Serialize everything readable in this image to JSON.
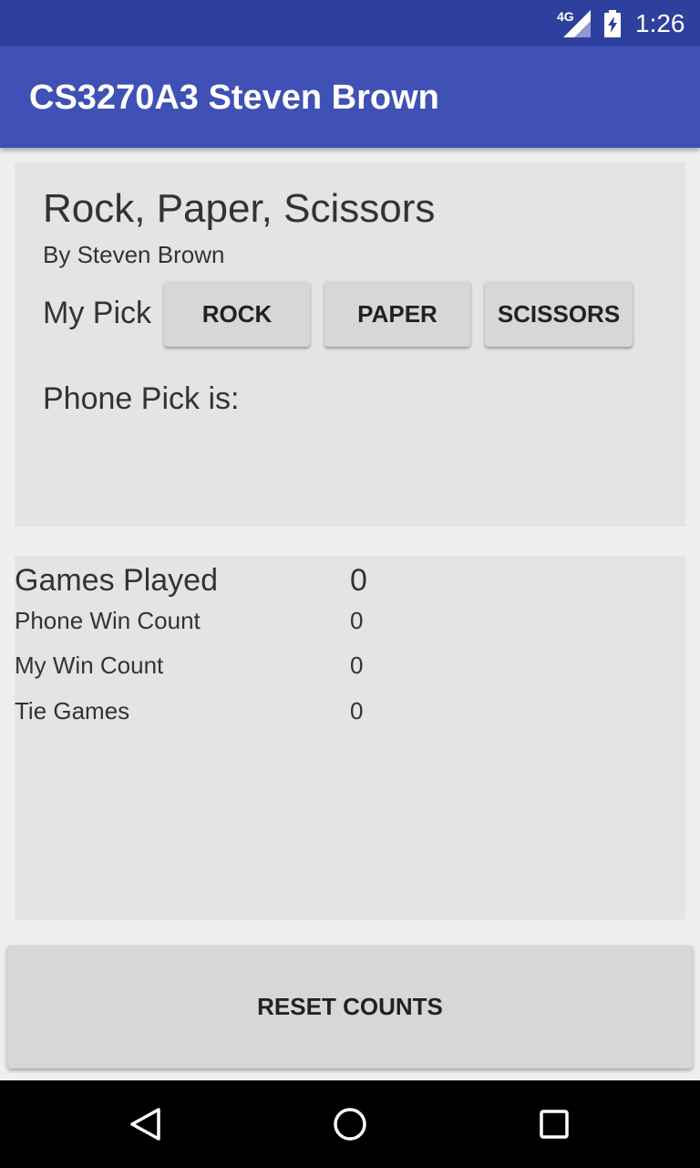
{
  "status_bar": {
    "network": "4G",
    "time": "1:26"
  },
  "app_bar": {
    "title": "CS3270A3 Steven Brown"
  },
  "game": {
    "title": "Rock, Paper, Scissors",
    "subtitle": "By Steven Brown",
    "my_pick_label": "My Pick",
    "buttons": {
      "rock": "ROCK",
      "paper": "PAPER",
      "scissors": "SCISSORS"
    },
    "phone_pick_label": "Phone Pick is:"
  },
  "stats": {
    "games_played_label": "Games Played",
    "games_played_value": "0",
    "phone_win_label": "Phone Win Count",
    "phone_win_value": "0",
    "my_win_label": "My Win Count",
    "my_win_value": "0",
    "tie_label": "Tie Games",
    "tie_value": "0"
  },
  "reset_button": "RESET COUNTS",
  "icons": {
    "signal": "cell-signal-icon",
    "battery": "battery-charging-icon",
    "back": "back-icon",
    "home": "home-icon",
    "recent": "recent-apps-icon"
  },
  "colors": {
    "status_bar": "#2f3f9e",
    "app_bar": "#3f51b5",
    "panel": "#e4e4e4",
    "button": "#d6d7d7"
  }
}
